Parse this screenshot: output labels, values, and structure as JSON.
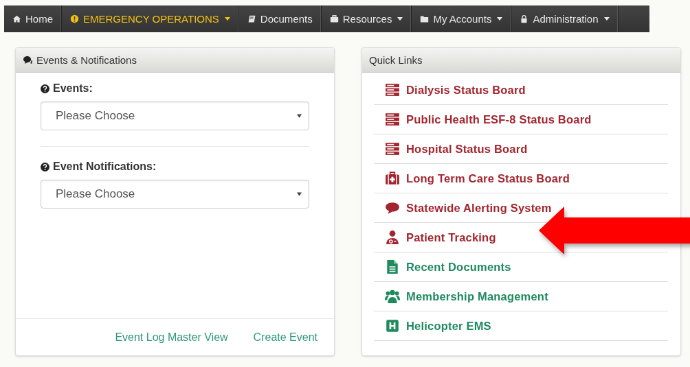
{
  "navbar": {
    "items": [
      {
        "label": "Home",
        "kind": "home",
        "selected": false,
        "has_menu": false
      },
      {
        "label": "EMERGENCY OPERATIONS",
        "kind": "alert",
        "selected": true,
        "has_menu": true
      },
      {
        "label": "Documents",
        "kind": "book",
        "selected": false,
        "has_menu": false
      },
      {
        "label": "Resources",
        "kind": "briefcase",
        "selected": false,
        "has_menu": true
      },
      {
        "label": "My Accounts",
        "kind": "folder",
        "selected": false,
        "has_menu": true
      },
      {
        "label": "Administration",
        "kind": "lock",
        "selected": false,
        "has_menu": true
      }
    ]
  },
  "events_panel": {
    "title": "Events & Notifications",
    "fields": [
      {
        "label": "Events:",
        "placeholder": "Please Choose"
      },
      {
        "label": "Event Notifications:",
        "placeholder": "Please Choose"
      }
    ],
    "footer_links": [
      "Event Log Master View",
      "Create Event"
    ]
  },
  "quick_links": {
    "title": "Quick Links",
    "items": [
      {
        "label": "Dialysis Status Board",
        "kind": "server",
        "color": "#a3262f",
        "highlighted": false
      },
      {
        "label": "Public Health ESF-8 Status Board",
        "kind": "server",
        "color": "#a3262f",
        "highlighted": false
      },
      {
        "label": "Hospital Status Board",
        "kind": "server",
        "color": "#a3262f",
        "highlighted": false
      },
      {
        "label": "Long Term Care Status Board",
        "kind": "medkit",
        "color": "#a3262f",
        "highlighted": false
      },
      {
        "label": "Statewide Alerting System",
        "kind": "comment",
        "color": "#a3262f",
        "highlighted": false
      },
      {
        "label": "Patient Tracking",
        "kind": "user-md",
        "color": "#a3262f",
        "highlighted": true
      },
      {
        "label": "Recent Documents",
        "kind": "file",
        "color": "#1e8a5e",
        "highlighted": false
      },
      {
        "label": "Membership Management",
        "kind": "users",
        "color": "#1e8a5e",
        "highlighted": false
      },
      {
        "label": "Helicopter EMS",
        "kind": "h-square",
        "color": "#1e8a5e",
        "highlighted": false
      }
    ]
  }
}
